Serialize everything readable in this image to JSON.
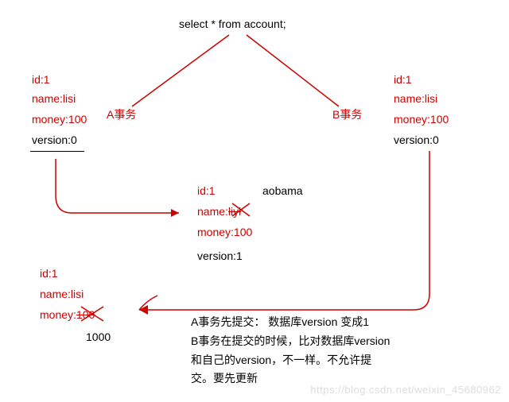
{
  "query": "select * from account;",
  "transactionA": {
    "label": "A事务",
    "id_line": "id:1",
    "name_line": "name:lisi",
    "money_line": "money:100",
    "version_line": "version:0"
  },
  "transactionB": {
    "label": "B事务",
    "id_line": "id:1",
    "name_line": "name:lisi",
    "money_line": "money:100",
    "version_line": "version:0"
  },
  "centerState": {
    "id_line": "id:1",
    "name_label": "name:",
    "name_old": "liyi",
    "name_new": "aobama",
    "money_line": "money:100",
    "version_line": "version:1"
  },
  "resultA": {
    "id_line": "id:1",
    "name_line": "name:lisi",
    "money_label": "money:",
    "money_old": "100",
    "money_new": "1000"
  },
  "explain": {
    "l1": "A事务先提交： 数据库version 变成1",
    "l2": "B事务在提交的时候，比对数据库version",
    "l3": "和自己的version，不一样。不允许提",
    "l4": "交。要先更新"
  },
  "watermark": "https://blog.csdn.net/weixin_45680962"
}
